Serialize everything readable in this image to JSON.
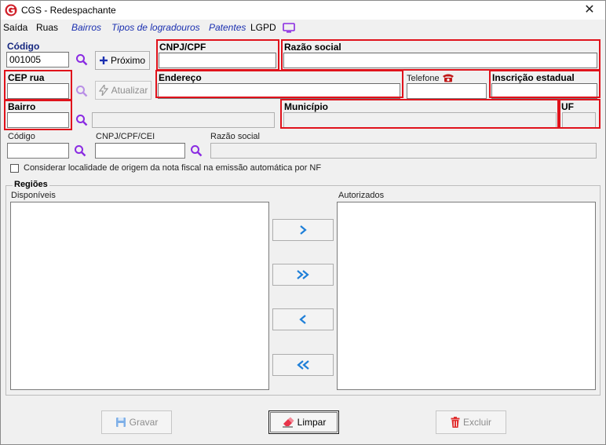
{
  "window": {
    "title": "CGS - Redespachante"
  },
  "menu": {
    "saida": "Saída",
    "ruas": "Ruas",
    "bairros": "Bairros",
    "tipos_logradouros": "Tipos de logradouros",
    "patentes": "Patentes",
    "lgpd": "LGPD"
  },
  "form": {
    "codigo_label": "Código",
    "codigo_value": "001005",
    "proximo_label": "Próximo",
    "cnpj_label": "CNPJ/CPF",
    "razao_label": "Razão social",
    "cep_label": "CEP rua",
    "atualizar_label": "Atualizar",
    "endereco_label": "Endereço",
    "telefone_label": "Telefone",
    "inscricao_label": "Inscrição estadual",
    "bairro_label": "Bairro",
    "municipio_label": "Município",
    "uf_label": "UF",
    "origem_codigo_label": "Código",
    "origem_cnpj_label": "CNPJ/CPF/CEI",
    "origem_razao_label": "Razão social",
    "considerar_label": "Considerar localidade de origem da nota fiscal na emissão automática por NF"
  },
  "regioes": {
    "title": "Regiões",
    "disponiveis_label": "Disponíveis",
    "autorizados_label": "Autorizados"
  },
  "footer": {
    "gravar_label": "Gravar",
    "limpar_label": "Limpar",
    "excluir_label": "Excluir"
  },
  "colors": {
    "highlight": "#e0121b",
    "menu_link": "#1a2fb0",
    "arrow": "#1e7fd8",
    "magnifier": "#8a2be2"
  }
}
